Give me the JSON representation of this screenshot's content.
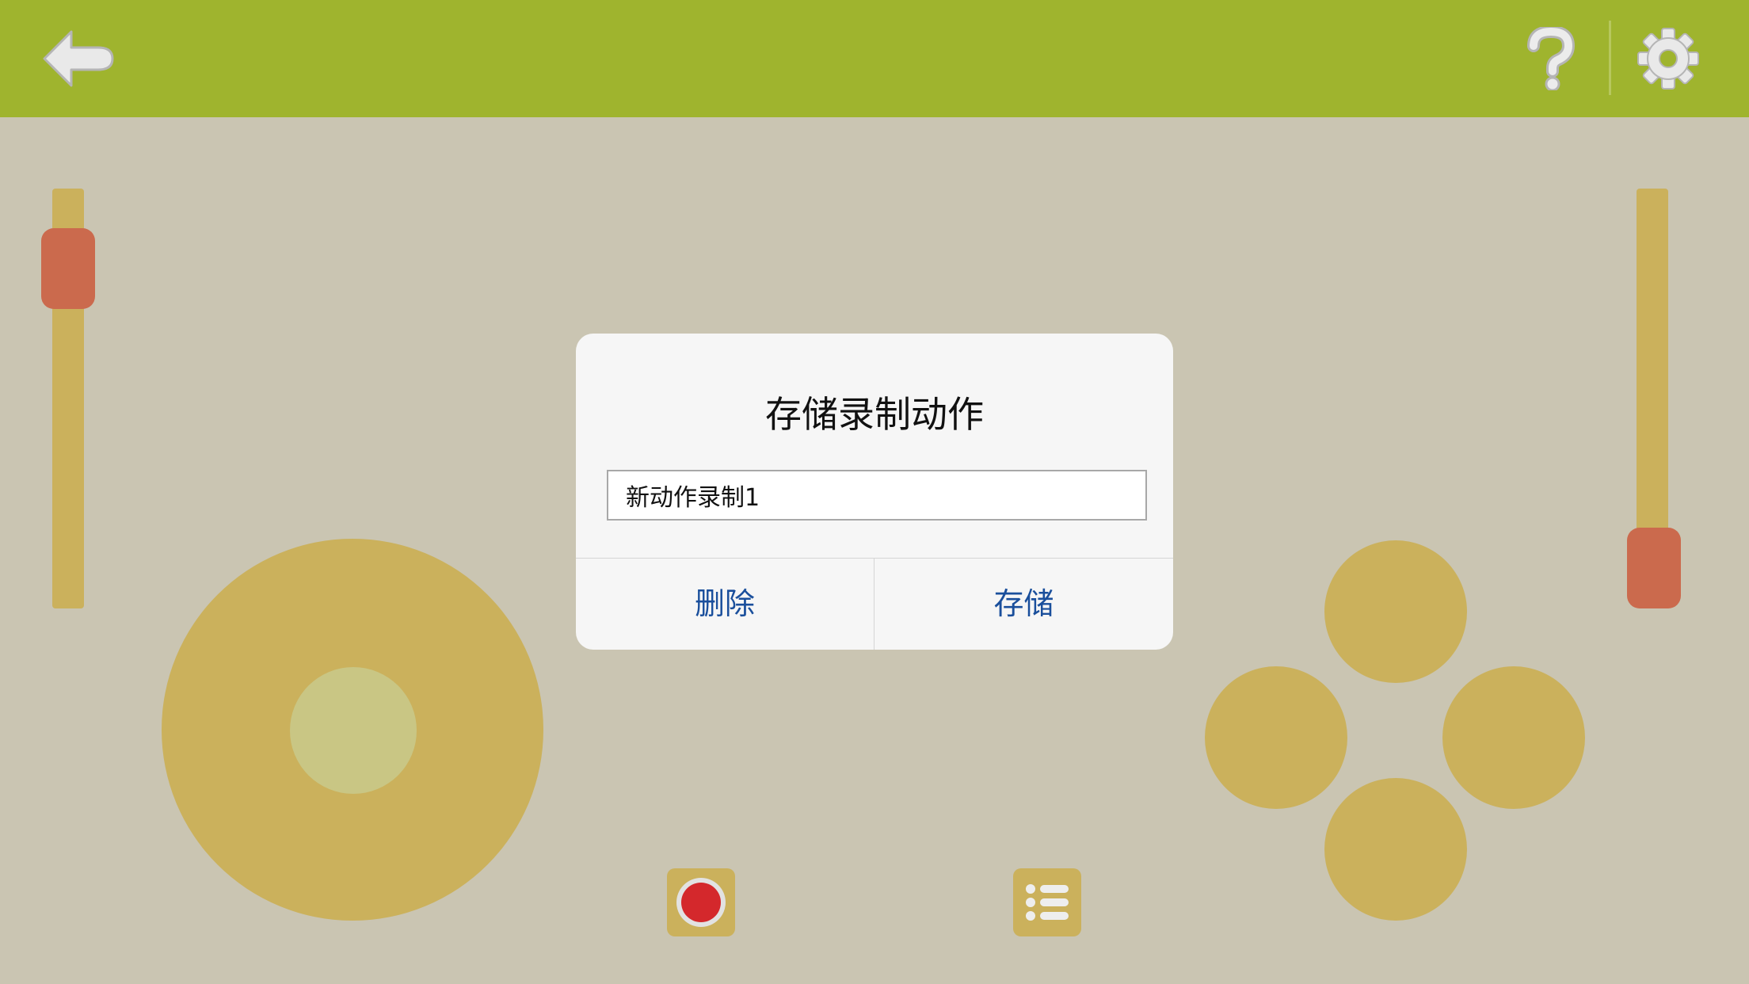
{
  "topbar": {
    "background": "#9fb42e",
    "back_icon": "back-arrow-icon",
    "help_icon": "question-mark-icon",
    "settings_icon": "gear-icon"
  },
  "controls": {
    "left_slider": {
      "level": 0.1
    },
    "right_slider": {
      "level": 0.82
    },
    "joystick": {
      "knob": "centered"
    },
    "action_buttons": [
      "up",
      "left",
      "right",
      "down"
    ],
    "record_icon": "record-icon",
    "list_icon": "list-icon",
    "accent_color": "#cbb15c",
    "handle_color": "#cb6a4d",
    "record_color": "#d4282c"
  },
  "dialog": {
    "title": "存储录制动作",
    "input_value": "新动作录制1",
    "delete_label": "删除",
    "save_label": "存储",
    "button_color": "#1a4f9c"
  }
}
